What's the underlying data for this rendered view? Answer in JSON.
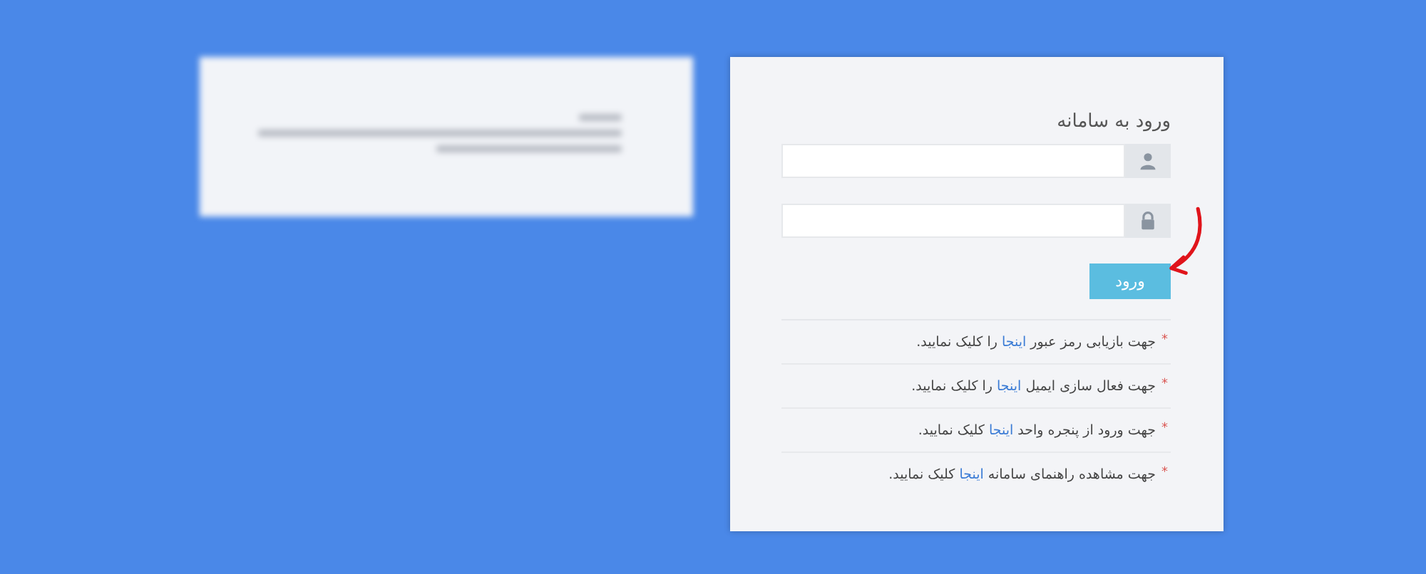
{
  "login": {
    "title": "ورود به سامانه",
    "fields": [
      {
        "kind": "username"
      },
      {
        "kind": "password"
      }
    ],
    "button": "ورود",
    "links": [
      {
        "bullet": "*",
        "before": "جهت بازیابی رمز عبور",
        "link": "اینجا",
        "after": "را کلیک نمایید."
      },
      {
        "bullet": "*",
        "before": "جهت فعال سازی ایمیل",
        "link": "اینجا",
        "after": "را کلیک نمایید."
      },
      {
        "bullet": "*",
        "before": "جهت ورود از پنجره واحد",
        "link": "اینجا",
        "after": "کلیک نمایید."
      },
      {
        "bullet": "*",
        "before": "جهت مشاهده راهنمای سامانه",
        "link": "اینجا",
        "after": "کلیک نمایید."
      }
    ]
  }
}
